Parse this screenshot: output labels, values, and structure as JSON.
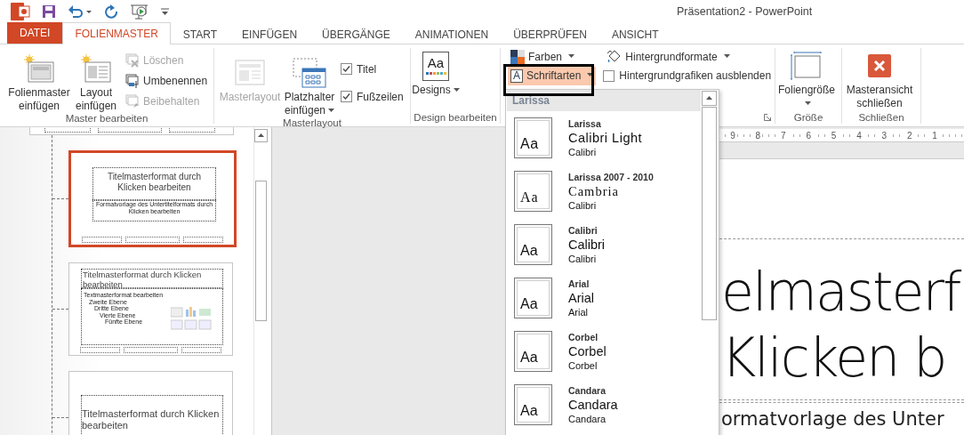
{
  "window": {
    "title": "Präsentation2 - PowerPoint"
  },
  "tabs": [
    {
      "label": "DATEI",
      "kind": "file",
      "selected": false
    },
    {
      "label": "FOLIENMASTER",
      "kind": "tab",
      "selected": true
    },
    {
      "label": "START",
      "kind": "tab",
      "selected": false
    },
    {
      "label": "EINFÜGEN",
      "kind": "tab",
      "selected": false
    },
    {
      "label": "ÜBERGÄNGE",
      "kind": "tab",
      "selected": false
    },
    {
      "label": "ANIMATIONEN",
      "kind": "tab",
      "selected": false
    },
    {
      "label": "ÜBERPRÜFEN",
      "kind": "tab",
      "selected": false
    },
    {
      "label": "ANSICHT",
      "kind": "tab",
      "selected": false
    }
  ],
  "ribbon": {
    "groups": [
      {
        "label": "Master bearbeiten",
        "items": [
          {
            "kind": "large",
            "label": "Folienmaster einfügen",
            "disabled": false
          },
          {
            "kind": "large",
            "label": "Layout einfügen",
            "disabled": false
          },
          {
            "kind": "small",
            "label": "Löschen",
            "disabled": true
          },
          {
            "kind": "small",
            "label": "Umbenennen",
            "disabled": false
          },
          {
            "kind": "small",
            "label": "Beibehalten",
            "disabled": true
          }
        ]
      },
      {
        "label": "Masterlayout",
        "items": [
          {
            "kind": "large",
            "label": "Masterlayout",
            "disabled": true
          },
          {
            "kind": "large",
            "label": "Platzhalter einfügen",
            "disabled": false,
            "dropdown": true
          },
          {
            "kind": "checkbox",
            "label": "Titel",
            "checked": true
          },
          {
            "kind": "checkbox",
            "label": "Fußzeilen",
            "checked": true
          }
        ]
      },
      {
        "label": "Design bearbeiten",
        "items": [
          {
            "kind": "large",
            "label": "Designs",
            "glyph": "Aa",
            "disabled": false,
            "dropdown": true
          }
        ]
      },
      {
        "items": [
          {
            "kind": "small",
            "label": "Farben",
            "disabled": false,
            "dropdown": true
          },
          {
            "kind": "small",
            "label": "Hintergrundformate",
            "disabled": false,
            "dropdown": true
          },
          {
            "kind": "small",
            "label": "Schriftarten",
            "glyph": "A",
            "disabled": false,
            "dropdown": true,
            "selected": true
          },
          {
            "kind": "checkbox",
            "label": "Hintergrundgrafiken ausblenden",
            "checked": false
          },
          {
            "kind": "launcher"
          }
        ]
      },
      {
        "label": "Größe",
        "items": [
          {
            "kind": "large",
            "label": "Foliengröße",
            "disabled": false,
            "dropdown": true
          }
        ]
      },
      {
        "label": "Schließen",
        "items": [
          {
            "kind": "large",
            "label": "Masteransicht schließen",
            "disabled": false
          }
        ]
      }
    ]
  },
  "thumbnails": [
    {
      "kind": "footer-only",
      "selected": false
    },
    {
      "kind": "title",
      "selected": true,
      "title": "Titelmasterformat durch Klicken bearbeiten",
      "subtitle": "Formatvorlage des Untertitelformats durch Klicken bearbeiten"
    },
    {
      "kind": "content",
      "selected": false,
      "title": "Titelmasterformat durch Klicken bearbeiten",
      "levels": [
        "Textmasterformat bearbeiten",
        "Zweite Ebene",
        "Dritte Ebene",
        "Vierte Ebene",
        "Fünfte Ebene"
      ]
    },
    {
      "kind": "section",
      "selected": false,
      "title": "Titelmasterformat durch Klicken bearbeiten"
    }
  ],
  "ruler": {
    "labels": [
      "9",
      "8",
      "7",
      "6",
      "5",
      "4",
      "3",
      "2",
      "1"
    ]
  },
  "slide": {
    "title_lines": [
      "elmasterf",
      "Klicken b"
    ],
    "subtitle": "ormatvorlage des Unter"
  },
  "font_menu": {
    "header": "Larissa",
    "items": [
      {
        "sample": "Aa",
        "name": "Larissa",
        "heading": "Calibri Light",
        "body": "Calibri"
      },
      {
        "sample": "Aa",
        "name": "Larissa 2007 - 2010",
        "heading": "Cambria",
        "body": "Calibri"
      },
      {
        "sample": "Aa",
        "name": "Calibri",
        "heading": "Calibri",
        "body": "Calibri"
      },
      {
        "sample": "Aa",
        "name": "Arial",
        "heading": "Arial",
        "body": "Arial"
      },
      {
        "sample": "Aa",
        "name": "Corbel",
        "heading": "Corbel",
        "body": "Corbel"
      },
      {
        "sample": "Aa",
        "name": "Candara",
        "heading": "Candara",
        "body": "Candara"
      }
    ]
  }
}
